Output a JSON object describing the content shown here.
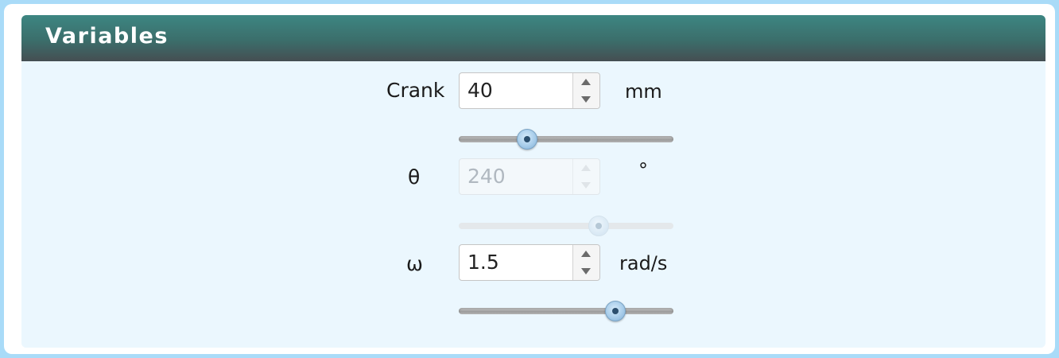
{
  "panel": {
    "title": "Variables"
  },
  "variables": [
    {
      "label": "Crank",
      "value": "40",
      "unit": "mm",
      "disabled": false,
      "slider_fraction": 0.32
    },
    {
      "label": "θ",
      "value": "240",
      "unit": "°",
      "disabled": true,
      "slider_fraction": 0.65
    },
    {
      "label": "ω",
      "value": "1.5",
      "unit": "rad/s",
      "disabled": false,
      "slider_fraction": 0.73
    }
  ],
  "colors": {
    "header_top": "#3d8682",
    "header_bottom": "#454e52",
    "panel_bg": "#ebf7fe",
    "frame": "#a9dbf8"
  }
}
